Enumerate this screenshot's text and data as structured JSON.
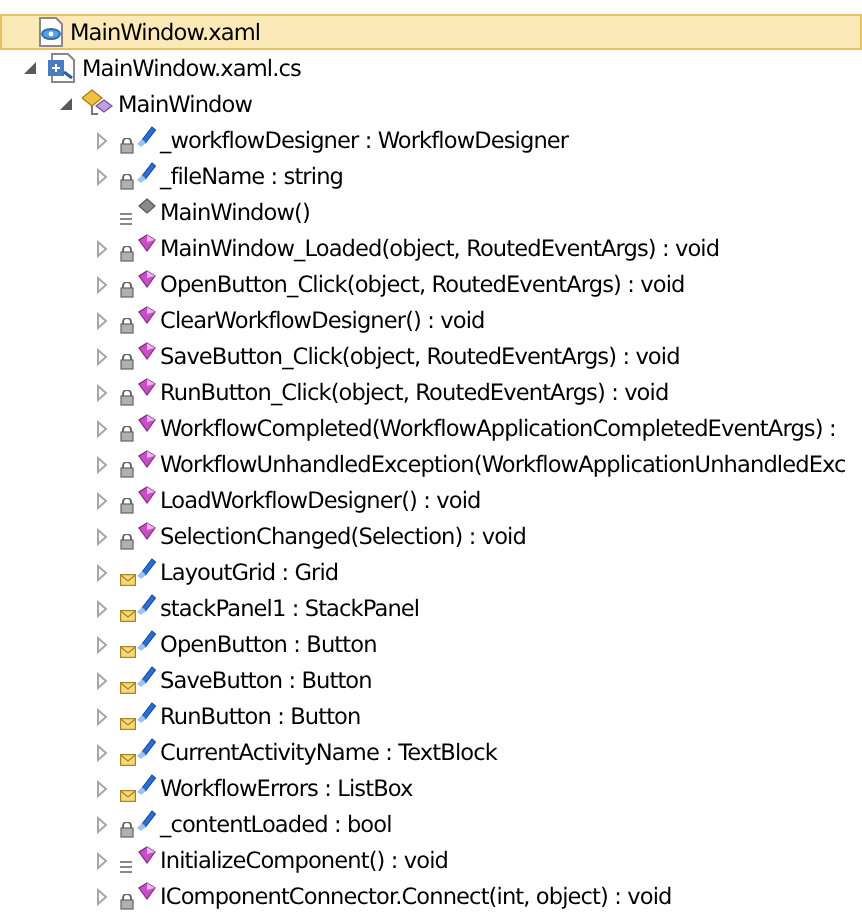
{
  "tree": [
    {
      "label": "MainWindow.xaml",
      "kind": "xaml-file",
      "selected": true,
      "children": [
        {
          "label": "MainWindow.xaml.cs",
          "kind": "cs-file",
          "selected": false,
          "expanded": true,
          "children": [
            {
              "label": "MainWindow",
              "kind": "class",
              "selected": false,
              "expanded": true,
              "children": [
                {
                  "label": "_workflowDesigner : WorkflowDesigner",
                  "kind": "private-field",
                  "selected": false,
                  "expanded": false
                },
                {
                  "label": "_fileName : string",
                  "kind": "private-field",
                  "selected": false,
                  "expanded": false
                },
                {
                  "label": "MainWindow()",
                  "kind": "public-constructor",
                  "selected": false
                },
                {
                  "label": "MainWindow_Loaded(object, RoutedEventArgs) : void",
                  "kind": "private-method",
                  "selected": false,
                  "expanded": false
                },
                {
                  "label": "OpenButton_Click(object, RoutedEventArgs) : void",
                  "kind": "private-method",
                  "selected": false,
                  "expanded": false
                },
                {
                  "label": "ClearWorkflowDesigner() : void",
                  "kind": "private-method",
                  "selected": false,
                  "expanded": false
                },
                {
                  "label": "SaveButton_Click(object, RoutedEventArgs) : void",
                  "kind": "private-method",
                  "selected": false,
                  "expanded": false
                },
                {
                  "label": "RunButton_Click(object, RoutedEventArgs) : void",
                  "kind": "private-method",
                  "selected": false,
                  "expanded": false
                },
                {
                  "label": "WorkflowCompleted(WorkflowApplicationCompletedEventArgs) :",
                  "kind": "private-method",
                  "selected": false,
                  "expanded": false
                },
                {
                  "label": "WorkflowUnhandledException(WorkflowApplicationUnhandledExc",
                  "kind": "private-method",
                  "selected": false,
                  "expanded": false
                },
                {
                  "label": "LoadWorkflowDesigner() : void",
                  "kind": "private-method",
                  "selected": false,
                  "expanded": false
                },
                {
                  "label": "SelectionChanged(Selection) : void",
                  "kind": "private-method",
                  "selected": false,
                  "expanded": false
                },
                {
                  "label": "LayoutGrid : Grid",
                  "kind": "internal-field",
                  "selected": false,
                  "expanded": false
                },
                {
                  "label": "stackPanel1 : StackPanel",
                  "kind": "internal-field",
                  "selected": false,
                  "expanded": false
                },
                {
                  "label": "OpenButton : Button",
                  "kind": "internal-field",
                  "selected": false,
                  "expanded": false
                },
                {
                  "label": "SaveButton : Button",
                  "kind": "internal-field",
                  "selected": false,
                  "expanded": false
                },
                {
                  "label": "RunButton : Button",
                  "kind": "internal-field",
                  "selected": false,
                  "expanded": false
                },
                {
                  "label": "CurrentActivityName : TextBlock",
                  "kind": "internal-field",
                  "selected": false,
                  "expanded": false
                },
                {
                  "label": "WorkflowErrors : ListBox",
                  "kind": "internal-field",
                  "selected": false,
                  "expanded": false
                },
                {
                  "label": "_contentLoaded : bool",
                  "kind": "private-field",
                  "selected": false,
                  "expanded": false
                },
                {
                  "label": "InitializeComponent() : void",
                  "kind": "public-method",
                  "selected": false,
                  "expanded": false
                },
                {
                  "label": "IComponentConnector.Connect(int, object) : void",
                  "kind": "private-method",
                  "selected": false,
                  "expanded": false
                }
              ]
            }
          ]
        }
      ]
    }
  ]
}
